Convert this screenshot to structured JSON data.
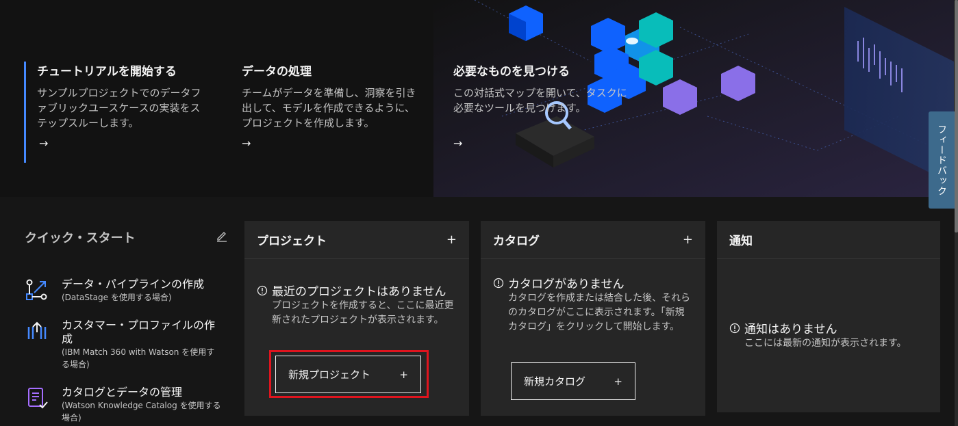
{
  "hero": {
    "cards": [
      {
        "title": "チュートリアルを開始する",
        "desc": "サンプルプロジェクトでのデータファブリックユースケースの実装をステップスルーします。",
        "arrow": "→"
      },
      {
        "title": "データの処理",
        "desc": "チームがデータを準備し、洞察を引き出して、モデルを作成できるように、プロジェクトを作成します。",
        "arrow": "→"
      },
      {
        "title": "必要なものを見つける",
        "desc": "この対話式マップを開いて、タスクに必要なツールを見つけます。",
        "arrow": "→"
      }
    ]
  },
  "feedback_label": "フィードバック",
  "quick_start": {
    "heading": "クイック・スタート",
    "items": [
      {
        "label": "データ・パイプラインの作成",
        "sub": "(DataStage を使用する場合)",
        "icon": "pipeline-icon"
      },
      {
        "label": "カスタマー・プロファイルの作成",
        "sub": "(IBM Match 360 with Watson を使用する場合)",
        "icon": "profile-match-icon"
      },
      {
        "label": "カタログとデータの管理",
        "sub": "(Watson Knowledge Catalog を使用する場合)",
        "icon": "catalog-icon"
      }
    ]
  },
  "tiles": {
    "projects": {
      "title": "プロジェクト",
      "plus": "+",
      "empty_title": "最近のプロジェクトはありません",
      "empty_desc": "プロジェクトを作成すると、ここに最近更新されたプロジェクトが表示されます。",
      "button": "新規プロジェクト",
      "button_plus": "+"
    },
    "catalogs": {
      "title": "カタログ",
      "plus": "+",
      "empty_title": "カタログがありません",
      "empty_desc": "カタログを作成または結合した後、それらのカタログがここに表示されます。「新規カタログ」をクリックして開始します。",
      "button": "新規カタログ",
      "button_plus": "+"
    },
    "notifications": {
      "title": "通知",
      "empty_title": "通知はありません",
      "empty_desc": "ここには最新の通知が表示されます。"
    }
  },
  "colors": {
    "accent": "#4589ff",
    "highlight": "#e0141e",
    "tile": "#262626",
    "background": "#161616"
  }
}
